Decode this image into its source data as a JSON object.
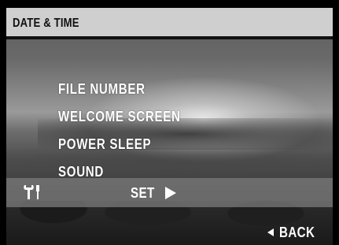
{
  "header": {
    "title": "DATE & TIME"
  },
  "menu": {
    "items": [
      {
        "label": "FILE NUMBER"
      },
      {
        "label": "WELCOME SCREEN"
      },
      {
        "label": "POWER SLEEP"
      },
      {
        "label": "SOUND"
      }
    ]
  },
  "bar": {
    "icon": "wrench-icon",
    "set_label": "SET",
    "set_icon": "play-arrow-icon"
  },
  "footer": {
    "back_label": "BACK",
    "back_icon": "back-arrow-icon"
  },
  "colors": {
    "header_bg": "#cfcfcf",
    "text": "#ffffff",
    "bar_bg": "#787878"
  }
}
